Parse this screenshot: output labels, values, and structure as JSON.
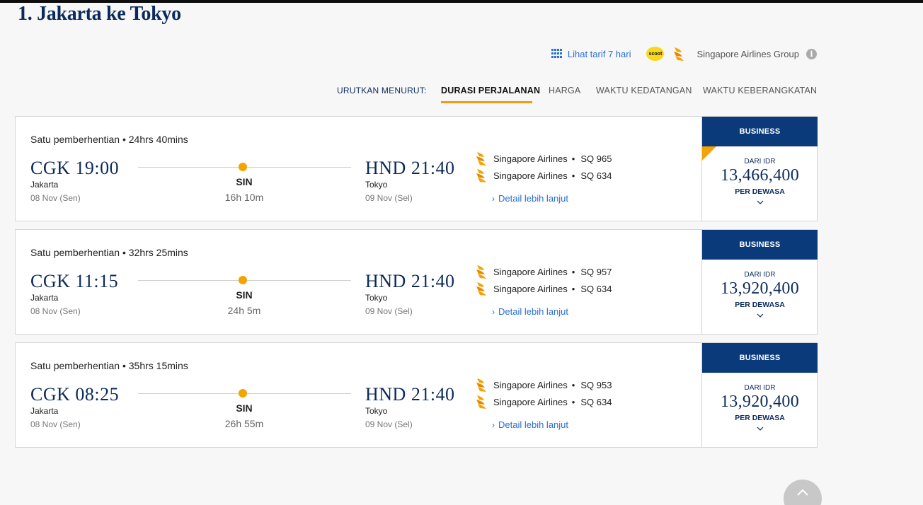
{
  "page": {
    "title": "1. Jakarta ke Tokyo"
  },
  "toolbar": {
    "view_7days_label": "Lihat tarif 7 hari",
    "scoot_logo_text": "scoot",
    "group_label": "Singapore Airlines Group",
    "info_icon": "i"
  },
  "sort": {
    "label": "URUTKAN MENURUT:",
    "options": [
      "DURASI PERJALANAN",
      "HARGA",
      "WAKTU KEDATANGAN",
      "WAKTU KEBERANGKATAN"
    ],
    "active": "DURASI PERJALANAN"
  },
  "flights": [
    {
      "stops": "Satu pemberhentian • 24hrs 40mins",
      "dep_time": "CGK 19:00",
      "dep_city": "Jakarta",
      "dep_date": "08 Nov (Sen)",
      "stop_code": "SIN",
      "duration": "16h 10m",
      "arr_time": "HND 21:40",
      "arr_city": "Tokyo",
      "arr_date": "09 Nov (Sel)",
      "segments": [
        {
          "airline": "Singapore Airlines",
          "sep": "•",
          "flight": "SQ 965"
        },
        {
          "airline": "Singapore Airlines",
          "sep": "•",
          "flight": "SQ 634"
        }
      ],
      "detail_label": "Detail lebih lanjut",
      "fare": {
        "class": "BUSINESS",
        "from": "DARI IDR",
        "price": "13,466,400",
        "per": "PER DEWASA",
        "highlight": true
      }
    },
    {
      "stops": "Satu pemberhentian • 32hrs 25mins",
      "dep_time": "CGK 11:15",
      "dep_city": "Jakarta",
      "dep_date": "08 Nov (Sen)",
      "stop_code": "SIN",
      "duration": "24h 5m",
      "arr_time": "HND 21:40",
      "arr_city": "Tokyo",
      "arr_date": "09 Nov (Sel)",
      "segments": [
        {
          "airline": "Singapore Airlines",
          "sep": "•",
          "flight": "SQ 957"
        },
        {
          "airline": "Singapore Airlines",
          "sep": "•",
          "flight": "SQ 634"
        }
      ],
      "detail_label": "Detail lebih lanjut",
      "fare": {
        "class": "BUSINESS",
        "from": "DARI IDR",
        "price": "13,920,400",
        "per": "PER DEWASA",
        "highlight": false
      }
    },
    {
      "stops": "Satu pemberhentian • 35hrs 15mins",
      "dep_time": "CGK 08:25",
      "dep_city": "Jakarta",
      "dep_date": "08 Nov (Sen)",
      "stop_code": "SIN",
      "duration": "26h 55m",
      "arr_time": "HND 21:40",
      "arr_city": "Tokyo",
      "arr_date": "09 Nov (Sel)",
      "segments": [
        {
          "airline": "Singapore Airlines",
          "sep": "•",
          "flight": "SQ 953"
        },
        {
          "airline": "Singapore Airlines",
          "sep": "•",
          "flight": "SQ 634"
        }
      ],
      "detail_label": "Detail lebih lanjut",
      "fare": {
        "class": "BUSINESS",
        "from": "DARI IDR",
        "price": "13,920,400",
        "per": "PER DEWASA",
        "highlight": false
      }
    }
  ],
  "icons": {
    "calendar": "calendar-icon",
    "airline_logo": "singapore-airlines-bird-icon",
    "detail_chevron": "chevron-right-icon",
    "fare_expand": "chevron-down-icon",
    "back_to_top": "chevron-up-icon"
  },
  "colors": {
    "navy": "#0b2a5b",
    "fare_header": "#0b3a7a",
    "accent": "#f5a300",
    "link": "#2a6fd1"
  }
}
